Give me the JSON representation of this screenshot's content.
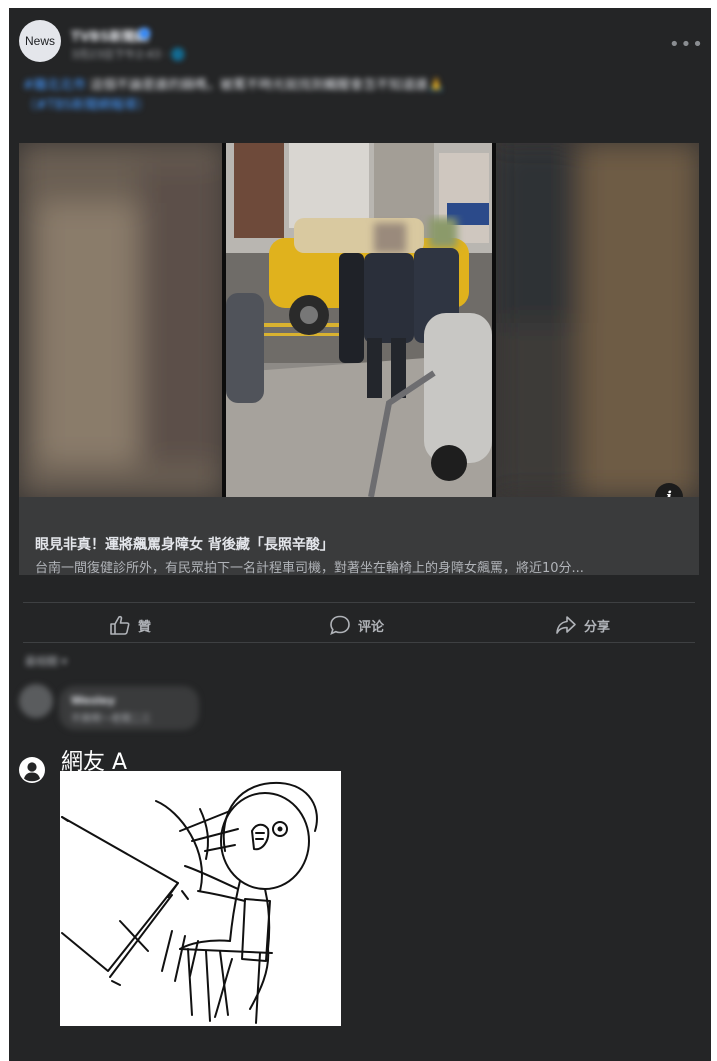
{
  "post": {
    "avatar_label": "News",
    "page_name": "TVBS新聞網",
    "time": "3月23日下午2:43 · 🌐",
    "more_icon": "more-horizontal-icon",
    "text_tag": "#離北北市",
    "text_body": "這個不論是誰的鍋嗎，被罵不時光就找到觸醒會怎不知道誰🙏",
    "text_line2": "（#TBS新聞網報導）"
  },
  "link": {
    "title": "眼見非真！運將飆罵身障女 背後藏「長照辛酸」",
    "description": "台南一間復健診所外，有民眾拍下一名計程車司機，對著坐在輪椅上的身障女飆罵，將近10分..."
  },
  "actions": {
    "like_label": "贊",
    "comment_label": "评论",
    "share_label": "分享"
  },
  "comments": {
    "sort_label": "最相關 ▾",
    "first_name": "Wesley",
    "first_text": "不爽啊～老闆二三"
  },
  "reply": {
    "user_name": "網友 A",
    "user_icon": "user-circle-icon",
    "image_icon": "table-flip-meme-icon"
  },
  "colors": {
    "card_bg": "#242526",
    "link_bg": "#3a3b3c",
    "text_primary": "#e4e6eb",
    "text_secondary": "#b0b3b8",
    "accent": "#2d88ff"
  }
}
